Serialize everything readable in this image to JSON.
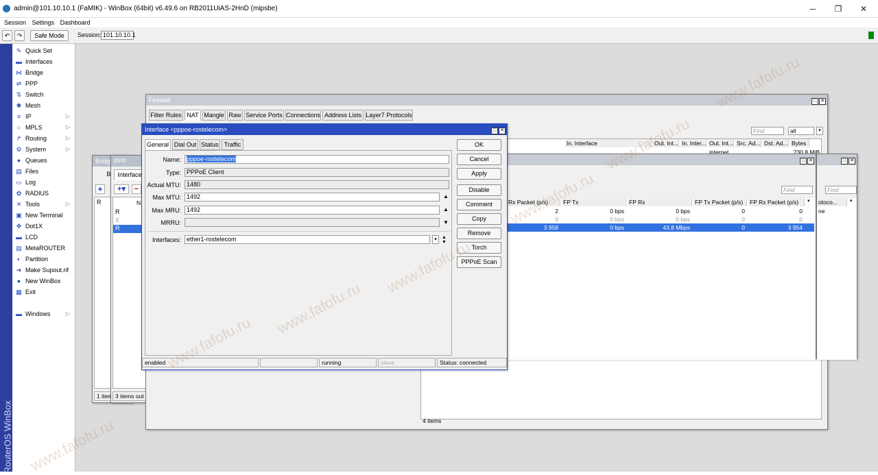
{
  "window": {
    "title": "admin@101.10.10.1 (FaMIK) - WinBox (64bit) v6.49.6 on RB2011UiAS-2HnD (mipsbe)"
  },
  "menu": [
    "Session",
    "Settings",
    "Dashboard"
  ],
  "toolbar": {
    "safe_mode": "Safe Mode",
    "session_label": "Session:",
    "session_value": "101.10.10.1"
  },
  "vertical_brand": "RouterOS WinBox",
  "sidebar": [
    {
      "label": "Quick Set",
      "icon": "quick-set"
    },
    {
      "label": "Interfaces",
      "icon": "interfaces"
    },
    {
      "label": "Bridge",
      "icon": "bridge"
    },
    {
      "label": "PPP",
      "icon": "ppp"
    },
    {
      "label": "Switch",
      "icon": "switch"
    },
    {
      "label": "Mesh",
      "icon": "mesh"
    },
    {
      "label": "IP",
      "icon": "ip",
      "sub": true
    },
    {
      "label": "MPLS",
      "icon": "mpls",
      "sub": true
    },
    {
      "label": "Routing",
      "icon": "routing",
      "sub": true
    },
    {
      "label": "System",
      "icon": "system",
      "sub": true
    },
    {
      "label": "Queues",
      "icon": "queues"
    },
    {
      "label": "Files",
      "icon": "files"
    },
    {
      "label": "Log",
      "icon": "log"
    },
    {
      "label": "RADIUS",
      "icon": "radius"
    },
    {
      "label": "Tools",
      "icon": "tools",
      "sub": true
    },
    {
      "label": "New Terminal",
      "icon": "terminal"
    },
    {
      "label": "Dot1X",
      "icon": "dot1x"
    },
    {
      "label": "LCD",
      "icon": "lcd"
    },
    {
      "label": "MetaROUTER",
      "icon": "metarouter"
    },
    {
      "label": "Partition",
      "icon": "partition"
    },
    {
      "label": "Make Supout.rif",
      "icon": "supout"
    },
    {
      "label": "New WinBox",
      "icon": "new-winbox"
    },
    {
      "label": "Exit",
      "icon": "exit"
    },
    {
      "label": "Windows",
      "icon": "windows",
      "sub": true
    }
  ],
  "bridge_win": {
    "title": "Bridge",
    "tab": "Bridg",
    "row": "R",
    "status": "1 item"
  },
  "ppp_win": {
    "title": "PPP",
    "tab": "Interface",
    "col": "N",
    "rows": [
      "R",
      "X",
      "R"
    ],
    "status": "3 items out"
  },
  "firewall": {
    "title": "Firewall",
    "tabs": [
      "Filter Rules",
      "NAT",
      "Mangle",
      "Raw",
      "Service Ports",
      "Connections",
      "Address Lists",
      "Layer7 Protocols"
    ],
    "find": "Find",
    "find_sel": "all",
    "headers": [
      "In. Interface",
      "Out. Int...",
      "In. Inter...",
      "Out. Int...",
      "Src. Ad...",
      "Dst. Ad...",
      "Bytes"
    ],
    "row1": {
      "out_int": "internet",
      "bytes": "230.8 MiB"
    },
    "status": "4 items"
  },
  "interfaces": {
    "find1": "Find",
    "find2": "Find",
    "headers": [
      "Rx Packet (p/s)",
      "FP Tx",
      "FP Rx",
      "FP Tx Packet (p/s)",
      "FP Rx Packet (p/s)",
      "otoco..."
    ],
    "rows": [
      {
        "rx_pkt": "2",
        "fp_tx": "0 bps",
        "fp_rx": "0 bps",
        "fp_tx_pkt": "0",
        "fp_rx_pkt": "0",
        "extra": "ne"
      },
      {
        "rx_pkt": "0",
        "fp_tx": "0 bps",
        "fp_rx": "0 bps",
        "fp_tx_pkt": "0",
        "fp_rx_pkt": "0",
        "extra": ""
      },
      {
        "rx_pkt": "3 958",
        "fp_tx": "0 bps",
        "fp_rx": "43.8 Mbps",
        "fp_tx_pkt": "0",
        "fp_rx_pkt": "3 954",
        "extra": ""
      }
    ]
  },
  "dialog": {
    "title": "Interface <pppoe-rostelecom>",
    "tabs": [
      "General",
      "Dial Out",
      "Status",
      "Traffic"
    ],
    "fields": {
      "name_label": "Name:",
      "name": "pppoe-rostelecom",
      "type_label": "Type:",
      "type": "PPPoE Client",
      "actual_mtu_label": "Actual MTU:",
      "actual_mtu": "1480",
      "max_mtu_label": "Max MTU:",
      "max_mtu": "1492",
      "max_mru_label": "Max MRU:",
      "max_mru": "1492",
      "mrru_label": "MRRU:",
      "mrru": "",
      "interfaces_label": "Interfaces:",
      "interfaces": "ether1-rostelecom"
    },
    "buttons": [
      "OK",
      "Cancel",
      "Apply",
      "Disable",
      "Comment",
      "Copy",
      "Remove",
      "Torch",
      "PPPoE Scan"
    ],
    "status": {
      "enabled": "enabled",
      "running": "running",
      "slave": "slave",
      "connection": "Status: connected"
    }
  },
  "watermark": "www.fafofu.ru"
}
